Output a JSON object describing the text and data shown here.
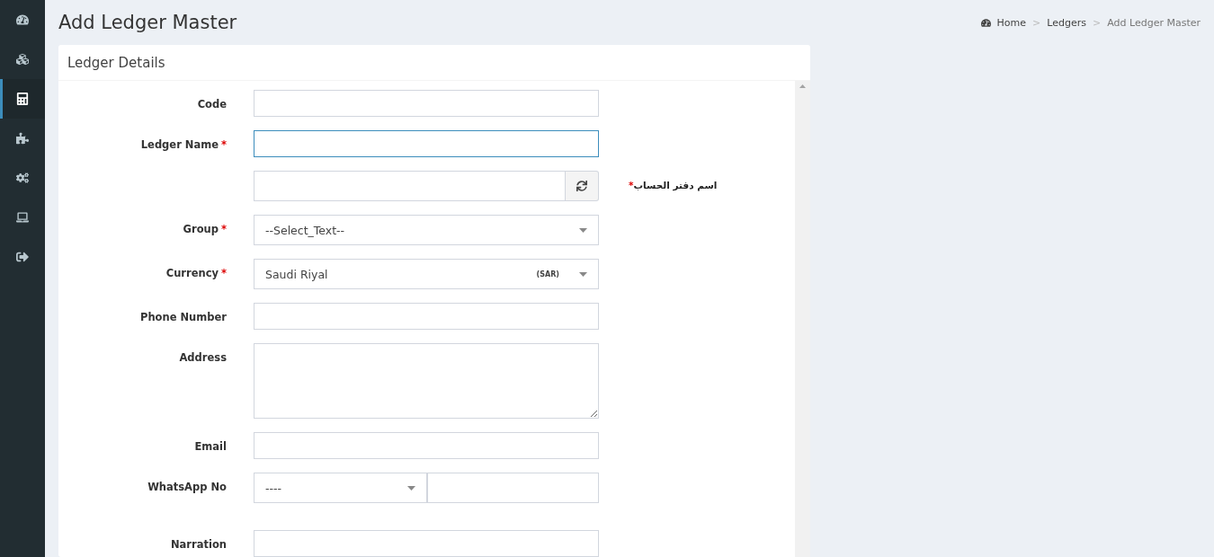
{
  "sidebar": {
    "items": [
      {
        "selected": false
      },
      {
        "selected": false
      },
      {
        "selected": true
      },
      {
        "selected": false
      },
      {
        "selected": false
      },
      {
        "selected": false
      },
      {
        "selected": false
      }
    ]
  },
  "page": {
    "title": "Add Ledger Master"
  },
  "breadcrumb": [
    {
      "label": "Home",
      "kind": "home"
    },
    {
      "label": "Ledgers",
      "kind": "link"
    },
    {
      "label": "Add Ledger Master",
      "kind": "current"
    }
  ],
  "separator": ">",
  "card": {
    "title": "Ledger Details"
  },
  "fields": [
    {
      "kind": "text",
      "label": "Code",
      "focused": false
    },
    {
      "kind": "text",
      "label": "Ledger Name",
      "mark": "*",
      "focused": true
    },
    {
      "kind": "addon",
      "side_label": "اسم دفتر الحساب",
      "mark": "*"
    },
    {
      "kind": "select",
      "label": "Group",
      "mark": "*",
      "value": "--Select_Text--"
    },
    {
      "kind": "select",
      "label": "Currency",
      "mark": "*",
      "value": "Saudi Riyal",
      "tag": "(SAR)"
    },
    {
      "kind": "text",
      "label": "Phone Number",
      "focused": false
    },
    {
      "kind": "textarea",
      "label": "Address"
    },
    {
      "kind": "text",
      "label": "Email",
      "focused": false
    },
    {
      "kind": "whatsapp",
      "label": "WhatsApp No",
      "value": "----"
    },
    {
      "kind": "text",
      "label": "Narration",
      "focused": false
    }
  ]
}
